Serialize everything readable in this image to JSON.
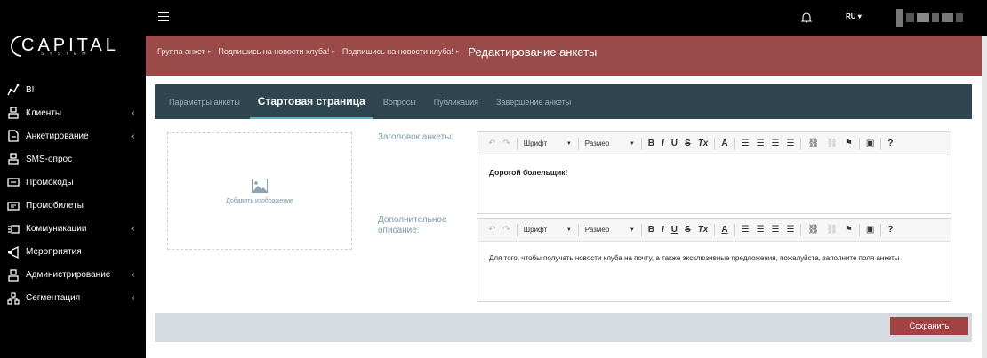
{
  "brand": {
    "logo_main": "CAPITAL",
    "logo_sub": "SYSTEM"
  },
  "topbar": {
    "language": "RU ▾"
  },
  "sidebar": {
    "items": [
      {
        "label": "BI",
        "icon": "bi-chart-icon",
        "has_submenu": false
      },
      {
        "label": "Клиенты",
        "icon": "users-icon",
        "has_submenu": true
      },
      {
        "label": "Анкетирование",
        "icon": "survey-icon",
        "has_submenu": true
      },
      {
        "label": "SMS-опрос",
        "icon": "sms-icon",
        "has_submenu": false
      },
      {
        "label": "Промокоды",
        "icon": "promo-code-icon",
        "has_submenu": false
      },
      {
        "label": "Промобилеты",
        "icon": "ticket-icon",
        "has_submenu": false
      },
      {
        "label": "Коммуникации",
        "icon": "communications-icon",
        "has_submenu": true
      },
      {
        "label": "Мероприятия",
        "icon": "events-icon",
        "has_submenu": false
      },
      {
        "label": "Администрирование",
        "icon": "admin-icon",
        "has_submenu": true
      },
      {
        "label": "Сегментация",
        "icon": "segmentation-icon",
        "has_submenu": true
      }
    ],
    "chevron": "‹"
  },
  "breadcrumb": {
    "items": [
      "Группа анкет",
      "Подпишись на новости клуба!",
      "Подпишись на новости клуба!"
    ],
    "separator": "▸",
    "current": "Редактирование анкеты"
  },
  "tabs": [
    {
      "label": "Параметры анкеты",
      "active": false
    },
    {
      "label": "Стартовая страница",
      "active": true
    },
    {
      "label": "Вопросы",
      "active": false
    },
    {
      "label": "Публикация",
      "active": false
    },
    {
      "label": "Завершение анкеты",
      "active": false
    }
  ],
  "uploader": {
    "label": "Добавить изображение"
  },
  "fields": {
    "title_label": "Заголовок анкеты:",
    "desc_label_line1": "Дополнительное",
    "desc_label_line2": "описание:"
  },
  "toolbar": {
    "font_label": "Шрифт",
    "size_label": "Размер",
    "bold": "B",
    "italic": "I",
    "underline": "U",
    "strike": "S",
    "clear": "Tx",
    "color": "A",
    "help": "?"
  },
  "editors": {
    "title_value": "Дорогой болельщик!",
    "description_value": "Для того, чтобы получать новости клуба на почту, а также эксклюзивные предложения, пожалуйста, заполните поля анкеты"
  },
  "actions": {
    "save_label": "Сохранить"
  },
  "colors": {
    "header_band": "#9b4a4a",
    "tabs_bg": "#2f4550",
    "tab_underline": "#5fb2c6",
    "save_button": "#a34242",
    "footer_bar": "#d5dbe0"
  }
}
